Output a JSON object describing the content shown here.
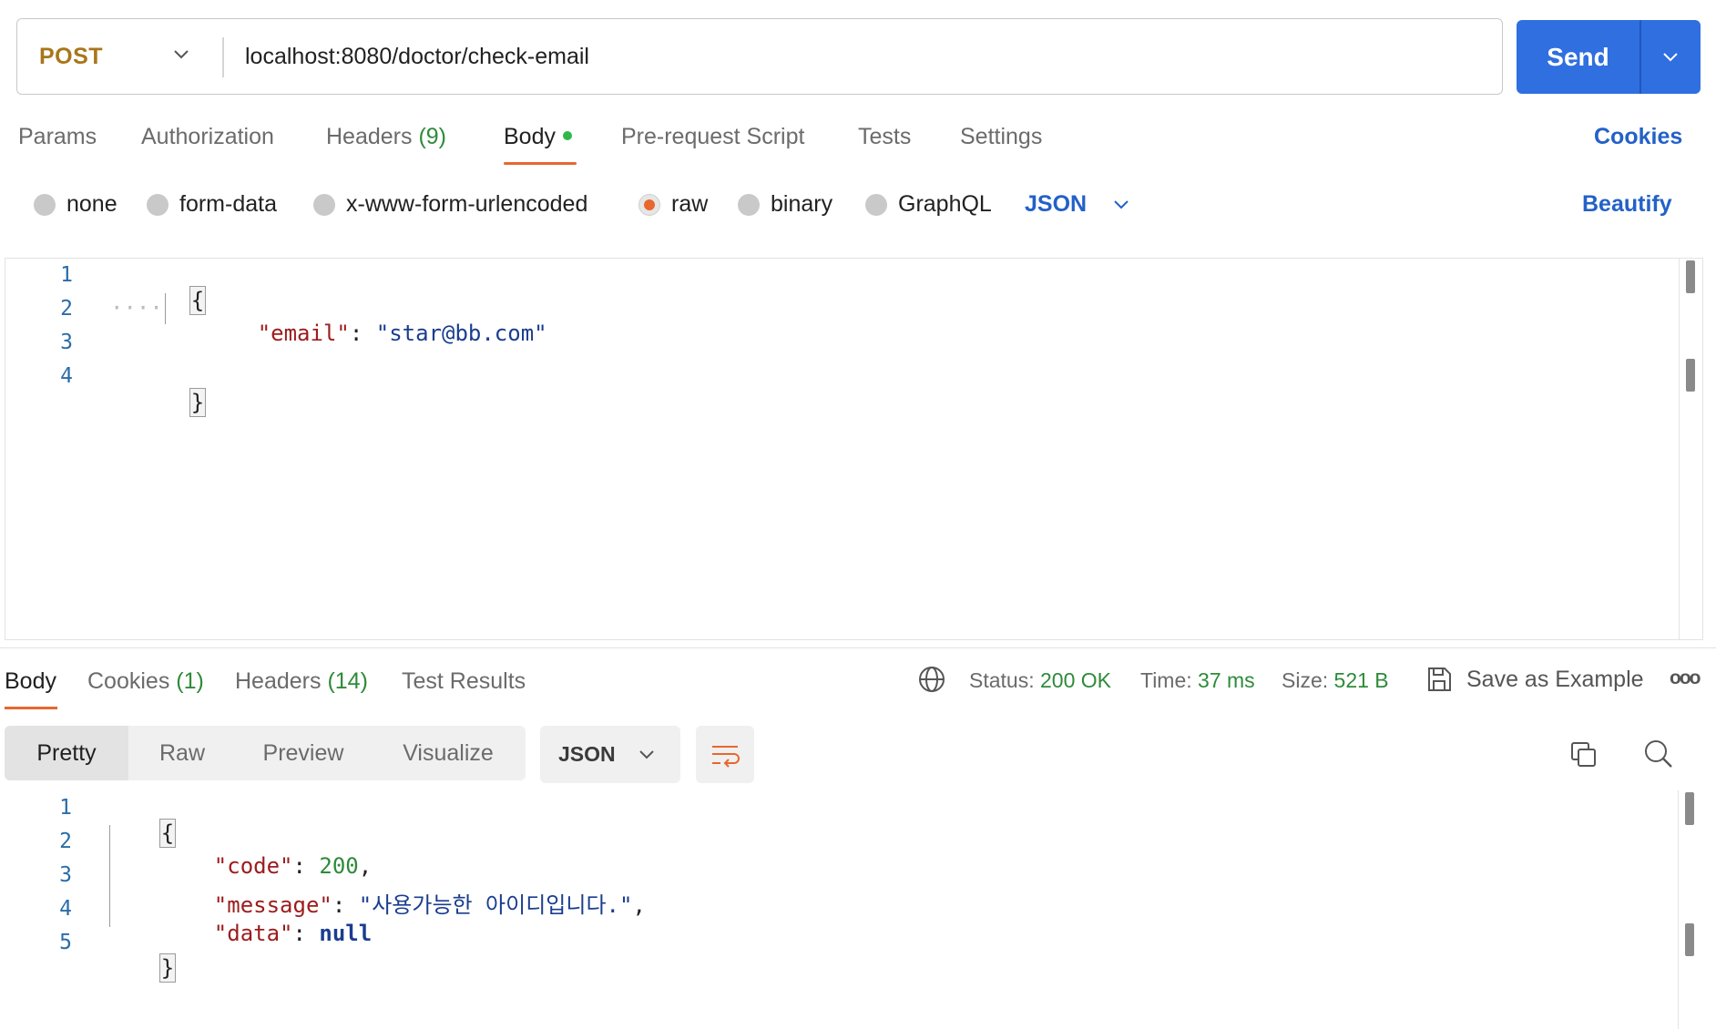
{
  "request": {
    "method": "POST",
    "url": "localhost:8080/doctor/check-email",
    "send_label": "Send"
  },
  "request_tabs": {
    "params": "Params",
    "authorization": "Authorization",
    "headers": "Headers",
    "headers_count": "(9)",
    "body": "Body",
    "prerequest": "Pre-request Script",
    "tests": "Tests",
    "settings": "Settings",
    "cookies": "Cookies"
  },
  "body_types": {
    "none": "none",
    "form_data": "form-data",
    "urlencoded": "x-www-form-urlencoded",
    "raw": "raw",
    "binary": "binary",
    "graphql": "GraphQL",
    "language": "JSON",
    "beautify": "Beautify",
    "selected": "raw"
  },
  "request_body": {
    "line_numbers": [
      "1",
      "2",
      "3",
      "4"
    ],
    "open_brace": "{",
    "key": "\"email\"",
    "colon": ":",
    "value": "\"star@bb.com\"",
    "close_brace": "}"
  },
  "response_tabs": {
    "body": "Body",
    "cookies": "Cookies",
    "cookies_count": "(1)",
    "headers": "Headers",
    "headers_count": "(14)",
    "test_results": "Test Results"
  },
  "response_meta": {
    "status_label": "Status:",
    "status_value": "200 OK",
    "time_label": "Time:",
    "time_value": "37 ms",
    "size_label": "Size:",
    "size_value": "521 B",
    "save_example": "Save as Example",
    "more": "ooo"
  },
  "response_view": {
    "pretty": "Pretty",
    "raw": "Raw",
    "preview": "Preview",
    "visualize": "Visualize",
    "format": "JSON"
  },
  "response_body": {
    "line_numbers": [
      "1",
      "2",
      "3",
      "4",
      "5"
    ],
    "open_brace": "{",
    "code_key": "\"code\"",
    "code_value": "200",
    "message_key": "\"message\"",
    "message_value": "\"사용가능한 아이디입니다.\"",
    "data_key": "\"data\"",
    "data_value": "null",
    "close_brace": "}"
  },
  "colors": {
    "accent": "#e8672d",
    "send_button": "#2f6fe0",
    "method": "#a8761a",
    "status_ok": "#2e8b3a",
    "link": "#2361c8"
  }
}
